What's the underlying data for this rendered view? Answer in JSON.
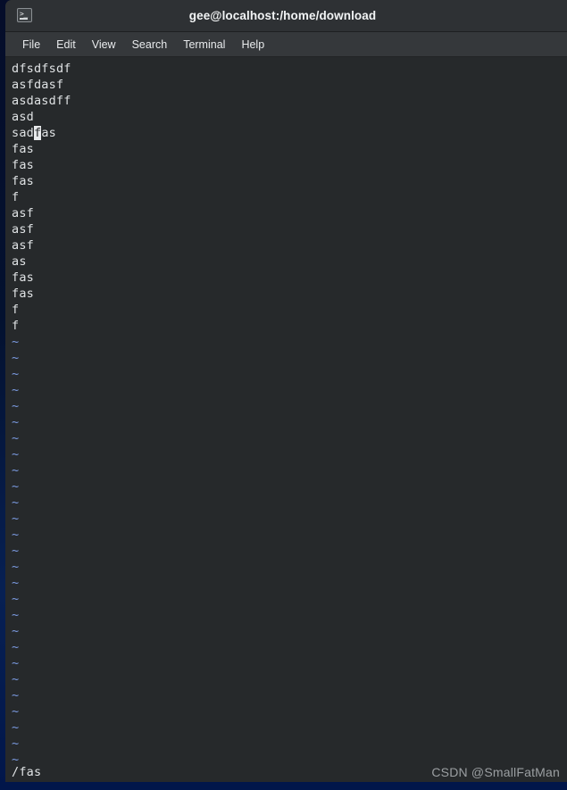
{
  "window": {
    "title": "gee@localhost:/home/download",
    "icon": "terminal-icon",
    "icon_glyph": ">_",
    "background_color": "#26292b",
    "titlebar_color": "#2e3134",
    "menubar_color": "#35383b",
    "page_background_color": "#041741"
  },
  "menubar": {
    "items": [
      {
        "label": "File"
      },
      {
        "label": "Edit"
      },
      {
        "label": "View"
      },
      {
        "label": "Search"
      },
      {
        "label": "Terminal"
      },
      {
        "label": "Help"
      }
    ]
  },
  "editor": {
    "text_color": "#dfe2e4",
    "tilde_color": "#7a9ae0",
    "cursor_color": "#e8eaec",
    "lines": [
      {
        "text": "dfsdfsdf"
      },
      {
        "text": "asfdasf"
      },
      {
        "text": "asdasdff"
      },
      {
        "text": "asd"
      },
      {
        "text": "sadfas",
        "cursor_index": 3
      },
      {
        "text": "fas"
      },
      {
        "text": "fas"
      },
      {
        "text": "fas"
      },
      {
        "text": "f"
      },
      {
        "text": "asf"
      },
      {
        "text": "asf"
      },
      {
        "text": "asf"
      },
      {
        "text": "as"
      },
      {
        "text": "fas"
      },
      {
        "text": "fas"
      },
      {
        "text": "f"
      },
      {
        "text": "f"
      }
    ],
    "empty_line_marker": "~",
    "empty_line_count": 27
  },
  "statusline": {
    "command": "/fas",
    "watermark": "CSDN @SmallFatMan"
  }
}
